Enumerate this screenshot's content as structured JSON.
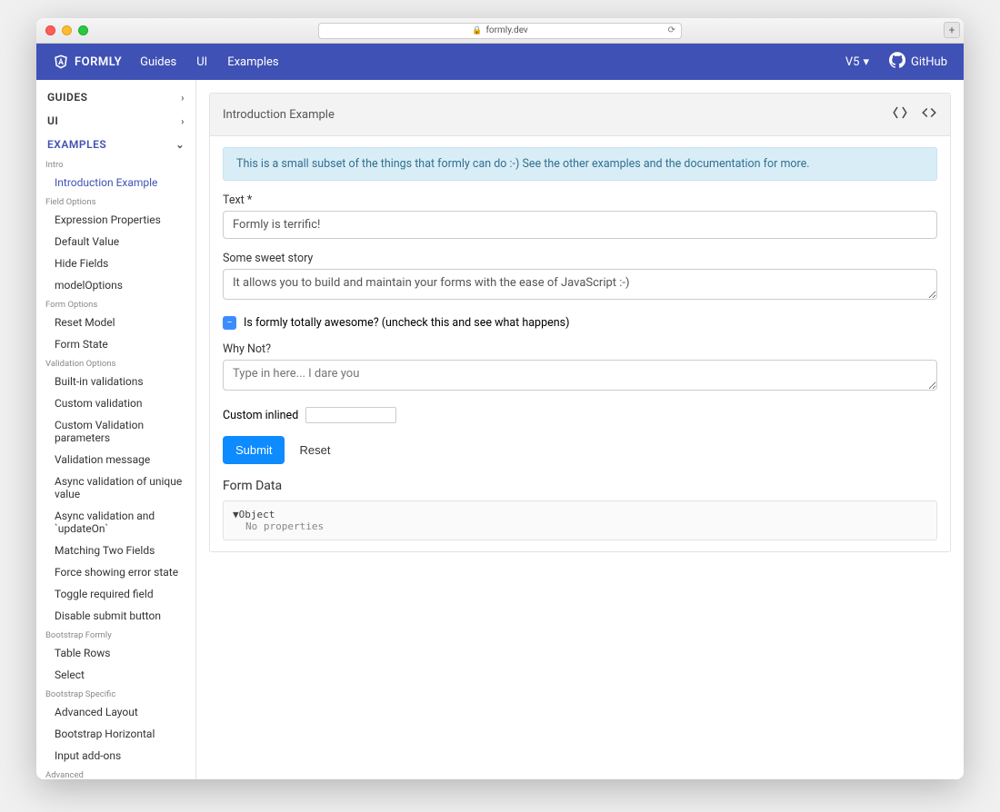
{
  "browser": {
    "url": "formly.dev"
  },
  "nav": {
    "brand": "FORMLY",
    "links": [
      "Guides",
      "UI",
      "Examples"
    ],
    "version": "V5",
    "github": "GitHub"
  },
  "sidebar": {
    "sections": [
      {
        "label": "GUIDES",
        "expanded": false
      },
      {
        "label": "UI",
        "expanded": false
      },
      {
        "label": "EXAMPLES",
        "expanded": true
      }
    ],
    "groups": [
      {
        "title": "Intro",
        "items": [
          "Introduction Example"
        ],
        "activeIndex": 0
      },
      {
        "title": "Field Options",
        "items": [
          "Expression Properties",
          "Default Value",
          "Hide Fields",
          "modelOptions"
        ]
      },
      {
        "title": "Form Options",
        "items": [
          "Reset Model",
          "Form State"
        ]
      },
      {
        "title": "Validation Options",
        "items": [
          "Built-in validations",
          "Custom validation",
          "Custom Validation parameters",
          "Validation message",
          "Async validation of unique value",
          "Async validation and `updateOn`",
          "Matching Two Fields",
          "Force showing error state",
          "Toggle required field",
          "Disable submit button"
        ]
      },
      {
        "title": "Bootstrap Formly",
        "items": [
          "Table Rows",
          "Select"
        ]
      },
      {
        "title": "Bootstrap Specific",
        "items": [
          "Advanced Layout",
          "Bootstrap Horizontal",
          "Input add-ons"
        ]
      },
      {
        "title": "Advanced",
        "items": []
      }
    ]
  },
  "page": {
    "title": "Introduction Example",
    "alert": "This is a small subset of the things that formly can do :-) See the other examples and the documentation for more.",
    "fields": {
      "text_label": "Text *",
      "text_value": "Formly is terrific!",
      "story_label": "Some sweet story",
      "story_value": "It allows you to build and maintain your forms with the ease of JavaScript :-)",
      "awesome_label": "Is formly totally awesome? (uncheck this and see what happens)",
      "whynot_label": "Why Not?",
      "whynot_placeholder": "Type in here... I dare you",
      "custom_label": "Custom inlined"
    },
    "buttons": {
      "submit": "Submit",
      "reset": "Reset"
    },
    "formdata_title": "Form Data",
    "formdata_object": "Object",
    "formdata_sub": "No properties"
  }
}
